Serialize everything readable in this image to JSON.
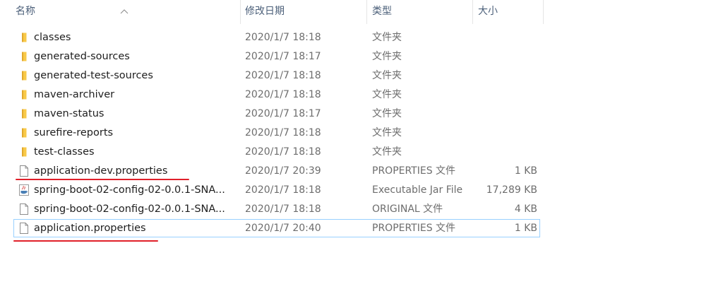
{
  "columns": {
    "name": "名称",
    "date": "修改日期",
    "type": "类型",
    "size": "大小"
  },
  "icons": {
    "sort": "chevron-up-icon",
    "folder": "folder-icon",
    "file": "file-icon",
    "jar": "java-jar-icon"
  },
  "colors": {
    "folder": "#f8c948",
    "selection_border": "#99d1ff",
    "annotation_underline": "#e0202a"
  },
  "files": [
    {
      "name": "classes",
      "date": "2020/1/7 18:18",
      "type": "文件夹",
      "size": "",
      "icon": "folder"
    },
    {
      "name": "generated-sources",
      "date": "2020/1/7 18:17",
      "type": "文件夹",
      "size": "",
      "icon": "folder"
    },
    {
      "name": "generated-test-sources",
      "date": "2020/1/7 18:18",
      "type": "文件夹",
      "size": "",
      "icon": "folder"
    },
    {
      "name": "maven-archiver",
      "date": "2020/1/7 18:18",
      "type": "文件夹",
      "size": "",
      "icon": "folder"
    },
    {
      "name": "maven-status",
      "date": "2020/1/7 18:17",
      "type": "文件夹",
      "size": "",
      "icon": "folder"
    },
    {
      "name": "surefire-reports",
      "date": "2020/1/7 18:18",
      "type": "文件夹",
      "size": "",
      "icon": "folder"
    },
    {
      "name": "test-classes",
      "date": "2020/1/7 18:18",
      "type": "文件夹",
      "size": "",
      "icon": "folder"
    },
    {
      "name": "application-dev.properties",
      "date": "2020/1/7 20:39",
      "type": "PROPERTIES 文件",
      "size": "1 KB",
      "icon": "file"
    },
    {
      "name": "spring-boot-02-config-02-0.0.1-SNA...",
      "date": "2020/1/7 18:18",
      "type": "Executable Jar File",
      "size": "17,289 KB",
      "icon": "jar"
    },
    {
      "name": "spring-boot-02-config-02-0.0.1-SNA...",
      "date": "2020/1/7 18:18",
      "type": "ORIGINAL 文件",
      "size": "4 KB",
      "icon": "file"
    },
    {
      "name": "application.properties",
      "date": "2020/1/7 20:40",
      "type": "PROPERTIES 文件",
      "size": "1 KB",
      "icon": "file"
    }
  ]
}
